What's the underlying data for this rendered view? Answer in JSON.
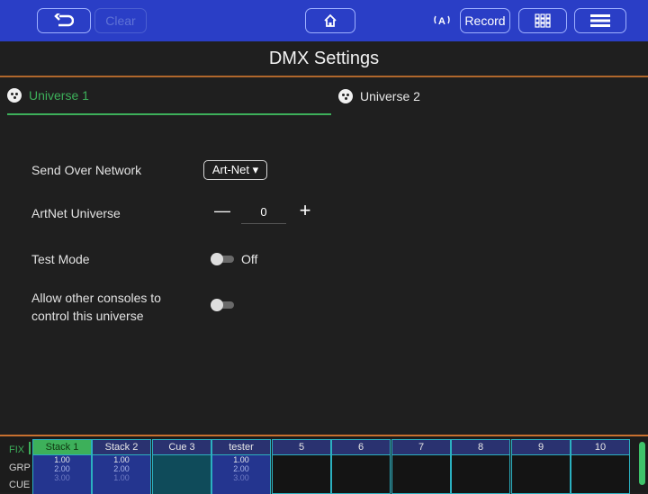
{
  "toolbar": {
    "clear_label": "Clear",
    "record_label": "Record"
  },
  "title": "DMX Settings",
  "tabs": [
    {
      "label": "Universe 1"
    },
    {
      "label": "Universe 2"
    }
  ],
  "settings": {
    "send_over_network": {
      "label": "Send Over Network",
      "value": "Art-Net ▾"
    },
    "artnet_universe": {
      "label": "ArtNet Universe",
      "value": "0",
      "minus": "—",
      "plus": "+"
    },
    "test_mode": {
      "label": "Test Mode",
      "state": "Off"
    },
    "allow_other": {
      "label_line1": "Allow other consoles to",
      "label_line2": "control this universe"
    }
  },
  "bottom": {
    "side_labels": [
      "FIX",
      "GRP",
      "CUE"
    ],
    "cues": [
      {
        "name": "Stack 1",
        "values": [
          "1.00",
          "2.00",
          "3.00"
        ]
      },
      {
        "name": "Stack 2",
        "values": [
          "1.00",
          "2.00",
          "1.00"
        ]
      },
      {
        "name": "Cue 3",
        "values": []
      },
      {
        "name": "tester",
        "values": [
          "1.00",
          "2.00",
          "3.00"
        ]
      },
      {
        "name": "5",
        "values": []
      },
      {
        "name": "6",
        "values": []
      },
      {
        "name": "7",
        "values": []
      },
      {
        "name": "8",
        "values": []
      },
      {
        "name": "9",
        "values": []
      },
      {
        "name": "10",
        "values": []
      }
    ]
  },
  "colors": {
    "accent_blue": "#2a3ec6",
    "active_green": "#3db05a",
    "divider_orange": "#c8702f"
  }
}
